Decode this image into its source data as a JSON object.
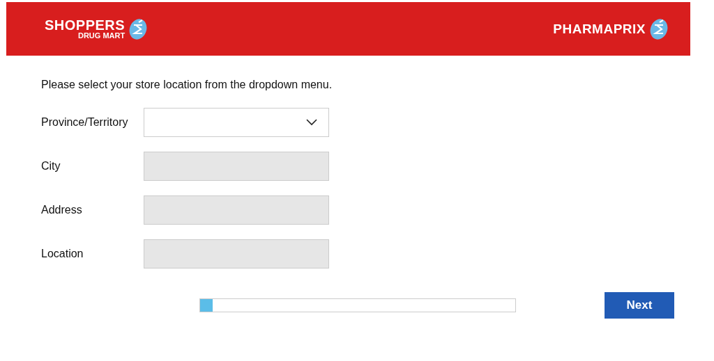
{
  "header": {
    "left_logo": {
      "name": "SHOPPERS",
      "subname": "DRUG MART"
    },
    "right_logo": {
      "name": "PHARMAPRIX"
    }
  },
  "instruction": "Please select your store location from the dropdown menu.",
  "fields": [
    {
      "label": "Province/Territory",
      "kind": "select",
      "disabled": false
    },
    {
      "label": "City",
      "kind": "select",
      "disabled": true
    },
    {
      "label": "Address",
      "kind": "select",
      "disabled": true
    },
    {
      "label": "Location",
      "kind": "select",
      "disabled": true
    }
  ],
  "progress": {
    "level": 0.04
  },
  "buttons": [
    {
      "label": "Next"
    }
  ]
}
